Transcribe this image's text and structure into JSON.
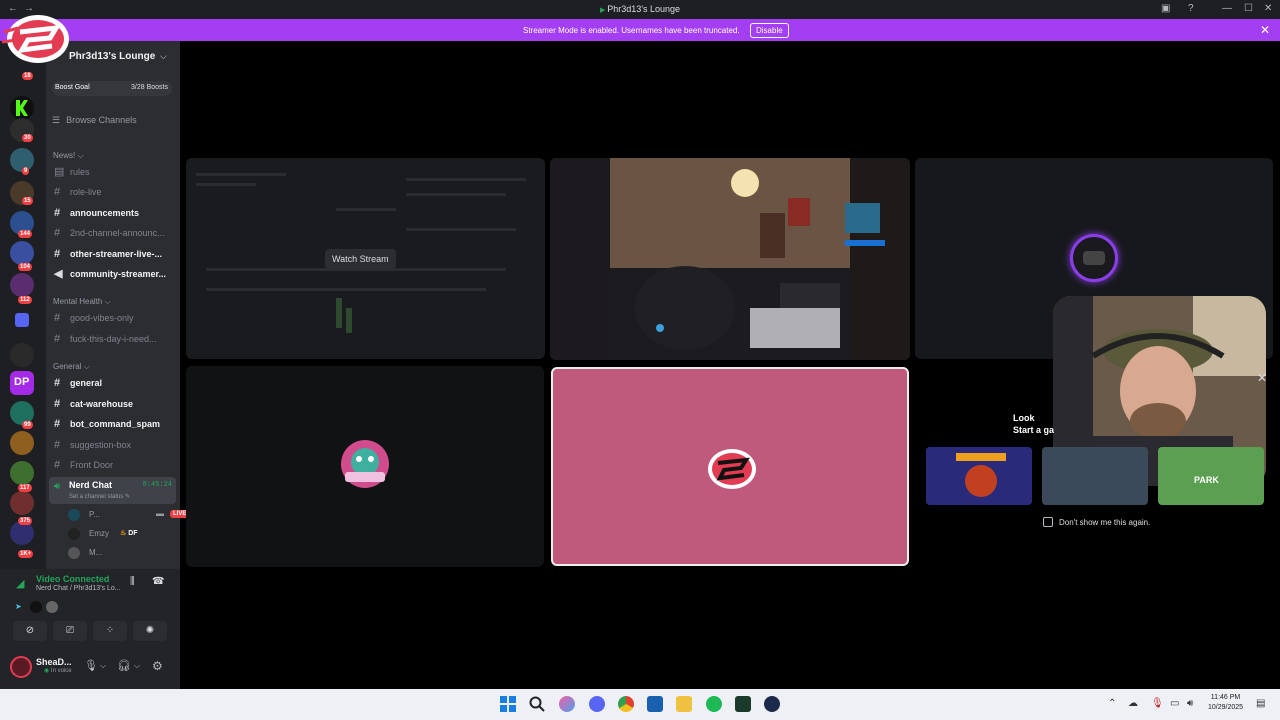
{
  "window": {
    "title": "Phr3d13's Lounge"
  },
  "banner": {
    "text": "Streamer Mode is enabled. Usernames have been truncated.",
    "button": "Disable",
    "close": "✕"
  },
  "guild_badges": [
    "18",
    "30",
    "9",
    "15",
    "144",
    "104",
    "112",
    "99",
    "117",
    "375",
    "1K+"
  ],
  "server": {
    "name": "Phr3d13's Lounge",
    "boost_label": "Boost Goal",
    "boost_value": "3/28 Boosts",
    "browse": "Browse Channels"
  },
  "categories": {
    "news": "News! ⌵",
    "mental": "Mental Health ⌵",
    "general": "General ⌵"
  },
  "channels": {
    "rules": "rules",
    "role_live": "role-live",
    "announcements": "announcements",
    "second_channel": "2nd-channel-announc...",
    "other_streamer": "other-streamer-live-...",
    "community": "community-streamer...",
    "good_vibes": "good-vibes-only",
    "fuck_this_day": "fuck-this-day-i-need...",
    "general": "general",
    "cat_warehouse": "cat-warehouse",
    "bot_command": "bot_command_spam",
    "suggestion": "suggestion-box",
    "front_door": "Front Door"
  },
  "voice_channel": {
    "name": "Nerd Chat",
    "time": "8:45:24",
    "status": "Set a channel status",
    "users": [
      {
        "name": "P...",
        "live": "LIVE"
      },
      {
        "name": "Emzy",
        "tag": "DF"
      },
      {
        "name": "M..."
      }
    ]
  },
  "voice_panel": {
    "status": "Video Connected",
    "channel": "Nerd Chat / Phr3d13's Lo..."
  },
  "user": {
    "name": "SheaD...",
    "status": "In voice"
  },
  "stage": {
    "watch_stream": "Watch Stream"
  },
  "activity": {
    "line1": "Look",
    "line2": "Start a ga",
    "dont_show": "Don't show me this again.",
    "game_text": "PARK"
  },
  "taskbar": {
    "time": "11:46 PM",
    "date": "10/29/2025"
  },
  "colors": {
    "brand_purple": "#a33ef3",
    "discord_green": "#23a55a",
    "live_red": "#f23f43",
    "pink_tile": "#c05a7d"
  }
}
